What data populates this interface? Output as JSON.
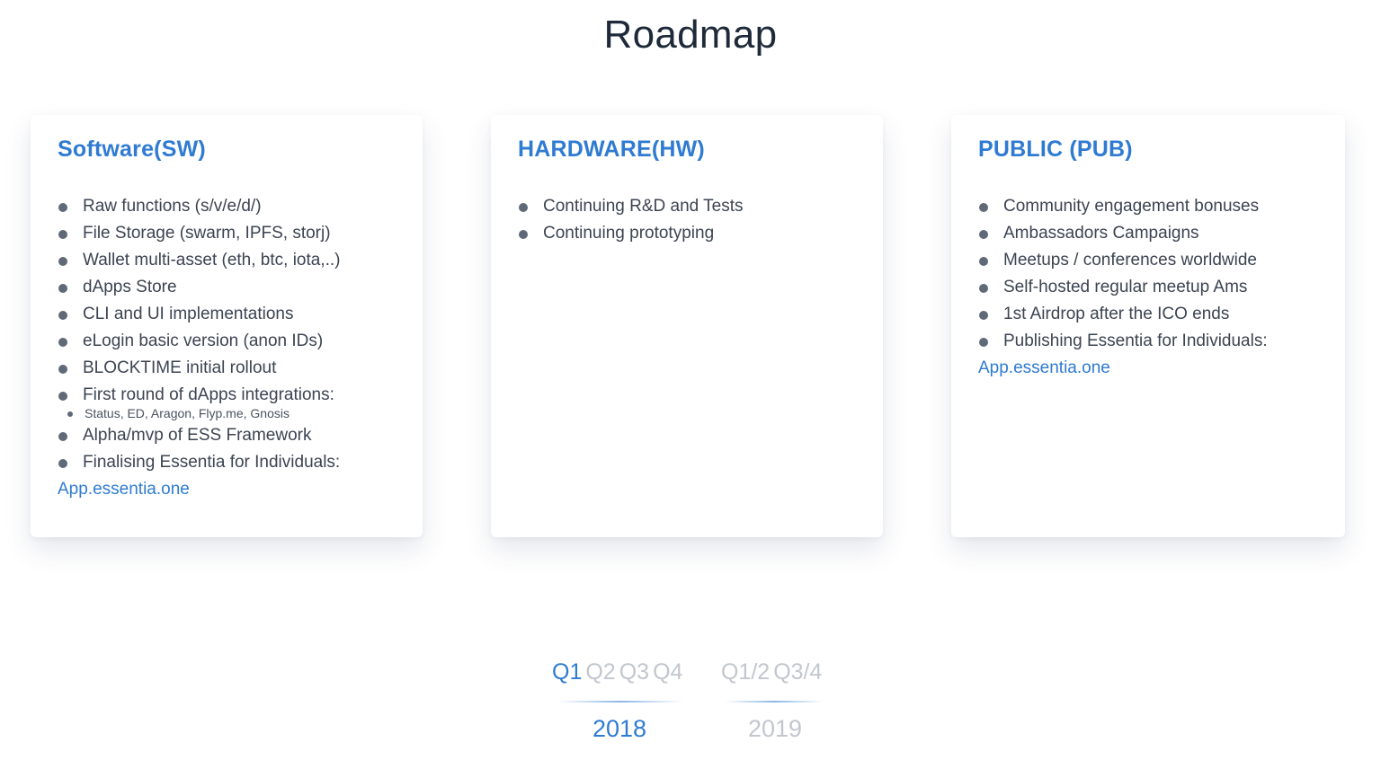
{
  "title": "Roadmap",
  "cards": [
    {
      "title": "Software(SW)",
      "items": [
        "Raw functions (s/v/e/d/)",
        "File Storage (swarm, IPFS, storj)",
        "Wallet multi-asset (eth, btc, iota,..)",
        "dApps Store",
        "CLI and UI implementations",
        "eLogin basic version (anon IDs)",
        "BLOCKTIME initial rollout",
        "First round of dApps integrations:",
        "Alpha/mvp of ESS Framework",
        "Finalising Essentia for Individuals:"
      ],
      "subitem": "Status, ED, Aragon, Flyp.me, Gnosis",
      "link": "App.essentia.one"
    },
    {
      "title": "HARDWARE(HW)",
      "items": [
        "Continuing R&D and Tests",
        "Continuing prototyping"
      ]
    },
    {
      "title": "PUBLIC (PUB)",
      "items": [
        "Community engagement bonuses",
        "Ambassadors Campaigns",
        "Meetups / conferences worldwide",
        "Self-hosted regular meetup Ams",
        "1st Airdrop after the ICO ends",
        "Publishing Essentia for Individuals:"
      ],
      "link": "App.essentia.one"
    }
  ],
  "timeline": {
    "year2018": {
      "quarters": [
        "Q1",
        "Q2",
        "Q3",
        "Q4"
      ],
      "active_quarter": "Q1",
      "label": "2018",
      "active": true
    },
    "year2019": {
      "quarters": [
        "Q1/2",
        "Q3/4"
      ],
      "label": "2019",
      "active": false
    }
  },
  "colors": {
    "accent": "#2f7bd1",
    "inactive": "#c2c7ce",
    "title": "#1e2a3a",
    "bullet": "#606977"
  }
}
